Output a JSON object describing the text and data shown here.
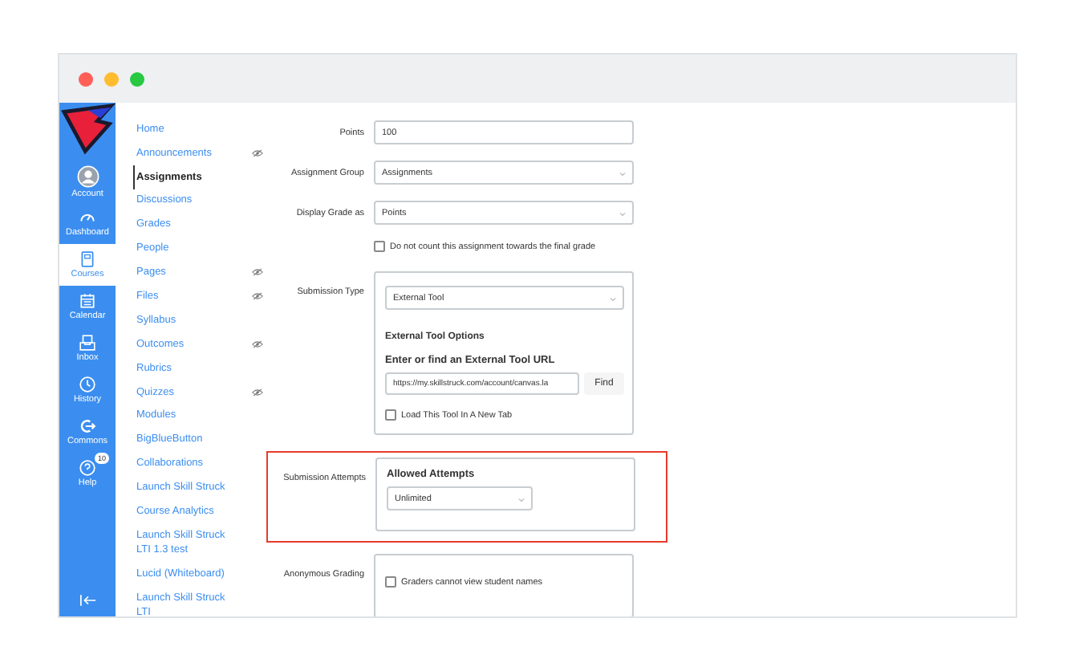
{
  "global_nav": [
    {
      "kind": "account",
      "label": "Account",
      "selected": false
    },
    {
      "kind": "dashboard",
      "label": "Dashboard",
      "selected": false
    },
    {
      "kind": "courses",
      "label": "Courses",
      "selected": true
    },
    {
      "kind": "calendar",
      "label": "Calendar",
      "selected": false
    },
    {
      "kind": "inbox",
      "label": "Inbox",
      "selected": false
    },
    {
      "kind": "history",
      "label": "History",
      "selected": false
    },
    {
      "kind": "commons",
      "label": "Commons",
      "selected": false
    },
    {
      "kind": "help",
      "label": "Help",
      "selected": false,
      "badge": "10"
    }
  ],
  "course_nav": [
    {
      "label": "Home",
      "selected": false,
      "hidden": false
    },
    {
      "label": "Announcements",
      "selected": false,
      "hidden": true
    },
    {
      "label": "Assignments",
      "selected": true,
      "hidden": false
    },
    {
      "label": "Discussions",
      "selected": false,
      "hidden": false
    },
    {
      "label": "Grades",
      "selected": false,
      "hidden": false
    },
    {
      "label": "People",
      "selected": false,
      "hidden": false
    },
    {
      "label": "Pages",
      "selected": false,
      "hidden": true
    },
    {
      "label": "Files",
      "selected": false,
      "hidden": true
    },
    {
      "label": "Syllabus",
      "selected": false,
      "hidden": false
    },
    {
      "label": "Outcomes",
      "selected": false,
      "hidden": true
    },
    {
      "label": "Rubrics",
      "selected": false,
      "hidden": false
    },
    {
      "label": "Quizzes",
      "selected": false,
      "hidden": true
    },
    {
      "label": "Modules",
      "selected": false,
      "hidden": false
    },
    {
      "label": "BigBlueButton",
      "selected": false,
      "hidden": false
    },
    {
      "label": "Collaborations",
      "selected": false,
      "hidden": false
    },
    {
      "label": "Launch Skill Struck",
      "selected": false,
      "hidden": false
    },
    {
      "label": "Course Analytics",
      "selected": false,
      "hidden": false
    },
    {
      "label": "Launch Skill Struck LTI 1.3 test",
      "selected": false,
      "hidden": false
    },
    {
      "label": "Lucid (Whiteboard)",
      "selected": false,
      "hidden": false
    },
    {
      "label": "Launch Skill Struck LTI",
      "selected": false,
      "hidden": false
    }
  ],
  "form": {
    "points": {
      "label": "Points",
      "value": "100"
    },
    "assignment_group": {
      "label": "Assignment Group",
      "value": "Assignments"
    },
    "display_grade_as": {
      "label": "Display Grade as",
      "value": "Points"
    },
    "exclude_checkbox": {
      "label": "Do not count this assignment towards the final grade",
      "checked": false
    },
    "submission_type": {
      "label": "Submission Type",
      "value": "External Tool",
      "options_title": "External Tool Options",
      "url_label": "Enter or find an External Tool URL",
      "url_value": "https://my.skillstruck.com/account/canvas.la",
      "find_button": "Find",
      "new_tab": {
        "label": "Load This Tool In A New Tab",
        "checked": false
      }
    },
    "submission_attempts": {
      "label": "Submission Attempts",
      "title": "Allowed Attempts",
      "value": "Unlimited",
      "highlighted": true
    },
    "anonymous_grading": {
      "label": "Anonymous Grading",
      "checkbox": {
        "label": "Graders cannot view student names",
        "checked": false
      }
    }
  }
}
